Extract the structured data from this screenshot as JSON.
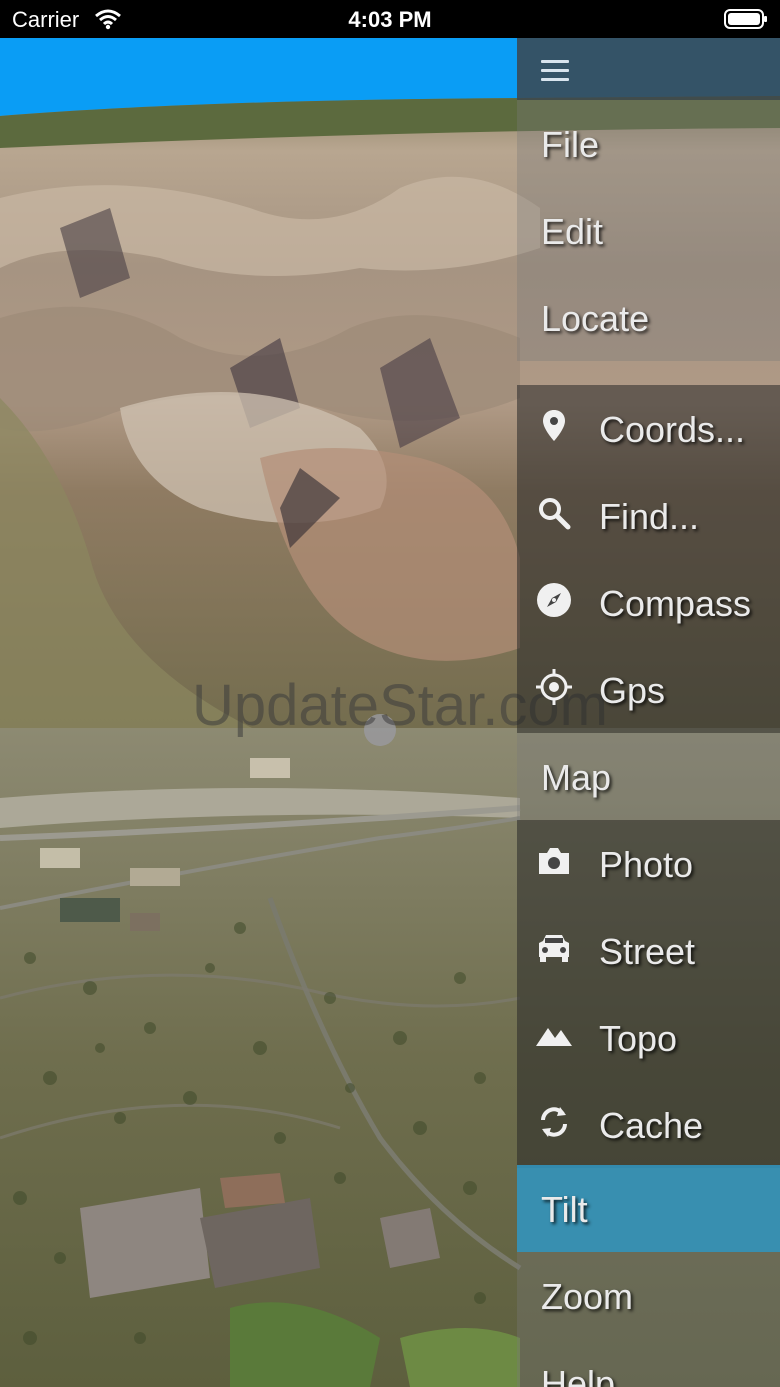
{
  "status_bar": {
    "carrier": "Carrier",
    "time": "4:03 PM"
  },
  "watermark": "UpdateStar.com",
  "menu": {
    "hamburger_icon": "menu-icon",
    "items": [
      {
        "label": "File",
        "kind": "section"
      },
      {
        "label": "Edit",
        "kind": "section"
      },
      {
        "label": "Locate",
        "kind": "section"
      },
      {
        "label": "Coords...",
        "kind": "sub",
        "icon": "map-pin-icon"
      },
      {
        "label": "Find...",
        "kind": "sub",
        "icon": "search-icon"
      },
      {
        "label": "Compass",
        "kind": "sub",
        "icon": "compass-icon"
      },
      {
        "label": "Gps",
        "kind": "sub",
        "icon": "gps-target-icon"
      },
      {
        "label": "Map",
        "kind": "section"
      },
      {
        "label": "Photo",
        "kind": "sub",
        "icon": "camera-icon"
      },
      {
        "label": "Street",
        "kind": "sub",
        "icon": "car-icon"
      },
      {
        "label": "Topo",
        "kind": "sub",
        "icon": "mountain-icon"
      },
      {
        "label": "Cache",
        "kind": "sub",
        "icon": "refresh-icon"
      },
      {
        "label": "Tilt",
        "kind": "active"
      },
      {
        "label": "Zoom",
        "kind": "section"
      },
      {
        "label": "Help",
        "kind": "section"
      }
    ]
  },
  "colors": {
    "sky": "#0a9df5",
    "active_item": "#3096c3",
    "menu_text": "#eaeaea"
  }
}
